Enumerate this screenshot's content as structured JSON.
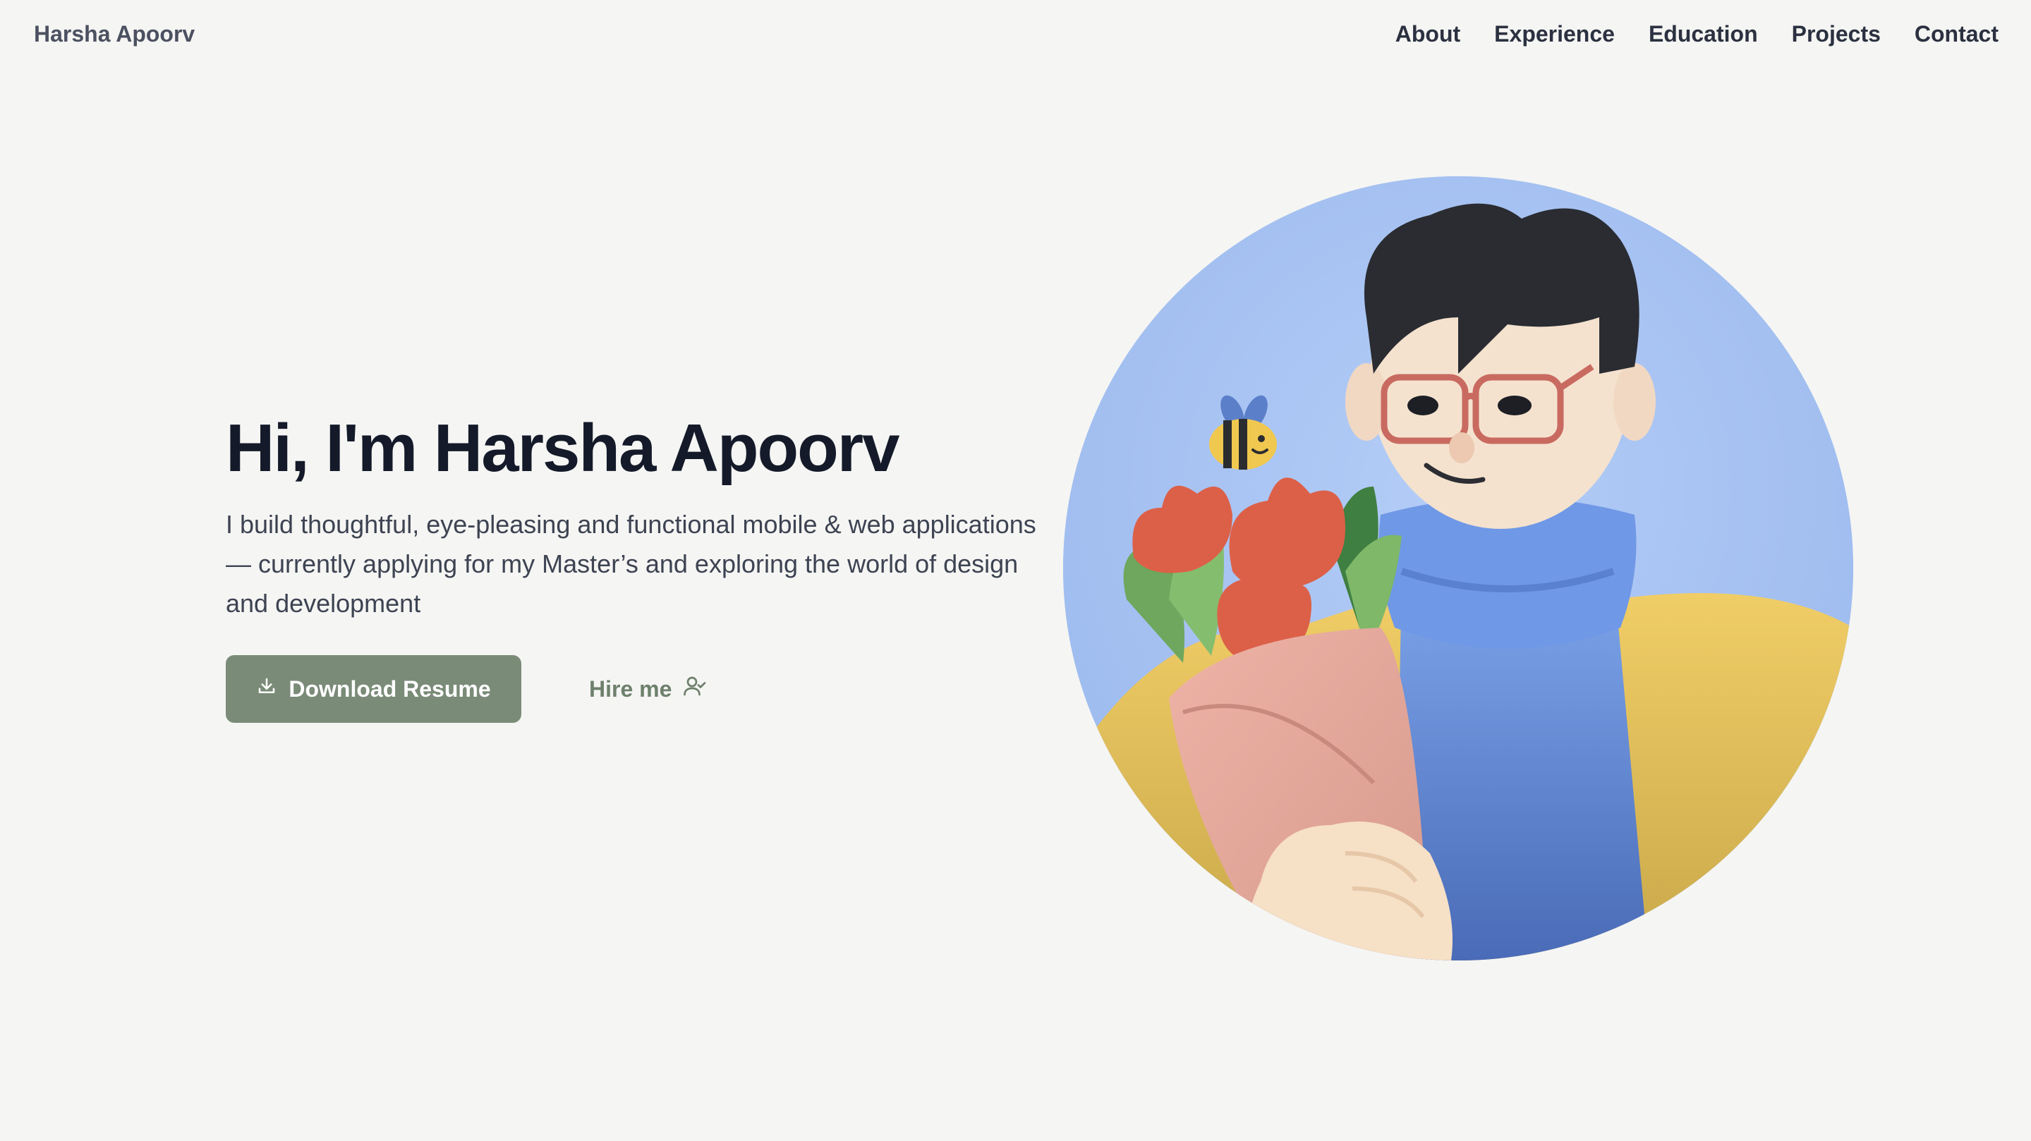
{
  "header": {
    "brand": "Harsha Apoorv",
    "nav": [
      "About",
      "Experience",
      "Education",
      "Projects",
      "Contact"
    ]
  },
  "hero": {
    "title": "Hi, I'm Harsha Apoorv",
    "description": "I build thoughtful, eye-pleasing and functional mobile & web applications — currently applying for my Master’s and exploring the world of design and development",
    "primary_button": "Download Resume",
    "secondary_button": "Hire me",
    "primary_icon": "download-icon",
    "secondary_icon": "user-check-icon"
  },
  "colors": {
    "background": "#f5f5f3",
    "primary": "#7a8b78",
    "accent_text": "#6e806c",
    "heading": "#141a29",
    "avatar_bg": "#a3bff0"
  }
}
